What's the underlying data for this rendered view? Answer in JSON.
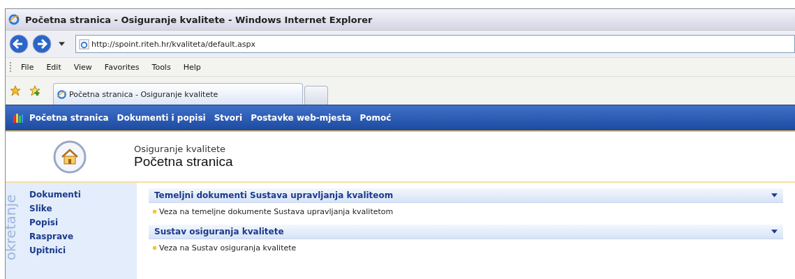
{
  "window": {
    "title": "Početna stranica - Osiguranje kvalitete - Windows Internet Explorer"
  },
  "address_bar": {
    "url": "http://spoint.riteh.hr/kvaliteta/default.aspx"
  },
  "menu_bar": [
    "File",
    "Edit",
    "View",
    "Favorites",
    "Tools",
    "Help"
  ],
  "tabs": [
    {
      "label": "Početna stranica - Osiguranje kvalitete",
      "selected": true
    }
  ],
  "top_nav": [
    "Početna stranica",
    "Dokumenti i popisi",
    "Stvori",
    "Postavke web-mjesta",
    "Pomoć"
  ],
  "header": {
    "site_name": "Osiguranje kvalitete",
    "page_title": "Početna stranica"
  },
  "quick_launch": {
    "label": "okretanje",
    "items": [
      "Dokumenti",
      "Slike",
      "Popisi",
      "Rasprave",
      "Upitnici"
    ]
  },
  "web_parts": [
    {
      "title": "Temeljni dokumenti Sustava upravljanja kvaliteom",
      "links": [
        "Veza na temeljne dokumente Sustava upravljanja kvalitetom"
      ]
    },
    {
      "title": "Sustav osiguranja kvalitete",
      "links": [
        "Veza na Sustav osiguranja kvalitete"
      ]
    }
  ]
}
